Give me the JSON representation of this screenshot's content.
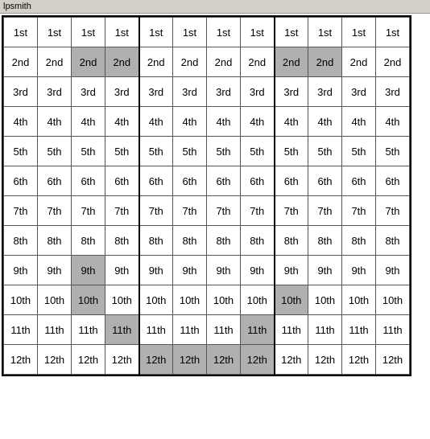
{
  "title": "lpsmith",
  "rows": [
    [
      "1st",
      "1st",
      "1st",
      "1st",
      "1st",
      "1st",
      "1st",
      "1st",
      "1st",
      "1st",
      "1st",
      "1st"
    ],
    [
      "2nd",
      "2nd",
      "2nd",
      "2nd",
      "2nd",
      "2nd",
      "2nd",
      "2nd",
      "2nd",
      "2nd",
      "2nd",
      "2nd"
    ],
    [
      "3rd",
      "3rd",
      "3rd",
      "3rd",
      "3rd",
      "3rd",
      "3rd",
      "3rd",
      "3rd",
      "3rd",
      "3rd",
      "3rd"
    ],
    [
      "4th",
      "4th",
      "4th",
      "4th",
      "4th",
      "4th",
      "4th",
      "4th",
      "4th",
      "4th",
      "4th",
      "4th"
    ],
    [
      "5th",
      "5th",
      "5th",
      "5th",
      "5th",
      "5th",
      "5th",
      "5th",
      "5th",
      "5th",
      "5th",
      "5th"
    ],
    [
      "6th",
      "6th",
      "6th",
      "6th",
      "6th",
      "6th",
      "6th",
      "6th",
      "6th",
      "6th",
      "6th",
      "6th"
    ],
    [
      "7th",
      "7th",
      "7th",
      "7th",
      "7th",
      "7th",
      "7th",
      "7th",
      "7th",
      "7th",
      "7th",
      "7th"
    ],
    [
      "8th",
      "8th",
      "8th",
      "8th",
      "8th",
      "8th",
      "8th",
      "8th",
      "8th",
      "8th",
      "8th",
      "8th"
    ],
    [
      "9th",
      "9th",
      "9th",
      "9th",
      "9th",
      "9th",
      "9th",
      "9th",
      "9th",
      "9th",
      "9th",
      "9th"
    ],
    [
      "10th",
      "10th",
      "10th",
      "10th",
      "10th",
      "10th",
      "10th",
      "10th",
      "10th",
      "10th",
      "10th",
      "10th"
    ],
    [
      "11th",
      "11th",
      "11th",
      "11th",
      "11th",
      "11th",
      "11th",
      "11th",
      "11th",
      "11th",
      "11th",
      "11th"
    ],
    [
      "12th",
      "12th",
      "12th",
      "12th",
      "12th",
      "12th",
      "12th",
      "12th",
      "12th",
      "12th",
      "12th",
      "12th"
    ]
  ],
  "highlighted": [
    [
      1,
      2
    ],
    [
      1,
      3
    ],
    [
      1,
      8
    ],
    [
      1,
      9
    ],
    [
      2,
      2
    ],
    [
      2,
      3
    ],
    [
      2,
      8
    ],
    [
      2,
      9
    ],
    [
      8,
      2
    ],
    [
      8,
      8
    ],
    [
      9,
      3
    ],
    [
      9,
      9
    ],
    [
      10,
      3
    ],
    [
      10,
      8
    ],
    [
      11,
      4
    ],
    [
      11,
      8
    ],
    [
      13,
      4
    ],
    [
      13,
      5
    ],
    [
      13,
      6
    ],
    [
      13,
      7
    ]
  ],
  "bold_right_cols": [
    3,
    7
  ],
  "bold_bottom_rows": []
}
